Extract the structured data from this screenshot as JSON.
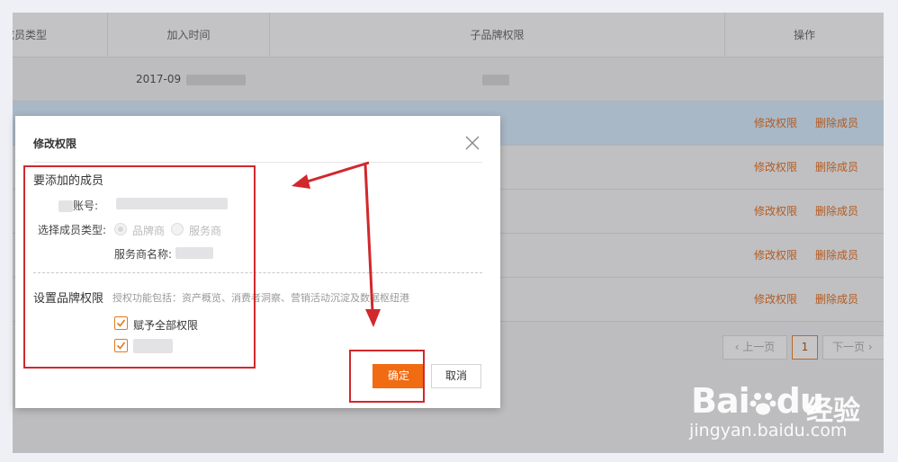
{
  "table": {
    "headers": [
      "成员类型",
      "加入时间",
      "子品牌权限",
      "操作"
    ],
    "rows": [
      {
        "date": "2017-09"
      },
      {
        "edit": "修改权限",
        "delete": "删除成员"
      },
      {
        "edit": "修改权限",
        "delete": "删除成员"
      },
      {
        "edit": "修改权限",
        "delete": "删除成员"
      },
      {
        "edit": "修改权限",
        "delete": "删除成员"
      },
      {
        "edit": "修改权限",
        "delete": "删除成员"
      }
    ]
  },
  "pagination": {
    "prev": "上一页",
    "current": "1",
    "next": "下一页"
  },
  "modal": {
    "title": "修改权限",
    "section_member": "要添加的成员",
    "account_label": "账号:",
    "member_type_label": "选择成员类型:",
    "option_brand": "品牌商",
    "option_service": "服务商",
    "service_name_label": "服务商名称:",
    "section_brand": "设置品牌权限",
    "brand_desc": "授权功能包括：资产概览、消费者洞察、营销活动沉淀及数据枢纽港",
    "checkbox_all": "赋予全部权限",
    "confirm": "确定",
    "cancel": "取消"
  },
  "watermark": {
    "brand": "Bai",
    "brand2": "du",
    "jingyan": "经验",
    "url": "jingyan.baidu.com"
  },
  "colors": {
    "accent": "#f06b12",
    "link": "#b55a1e",
    "annotation": "#d0282d"
  }
}
